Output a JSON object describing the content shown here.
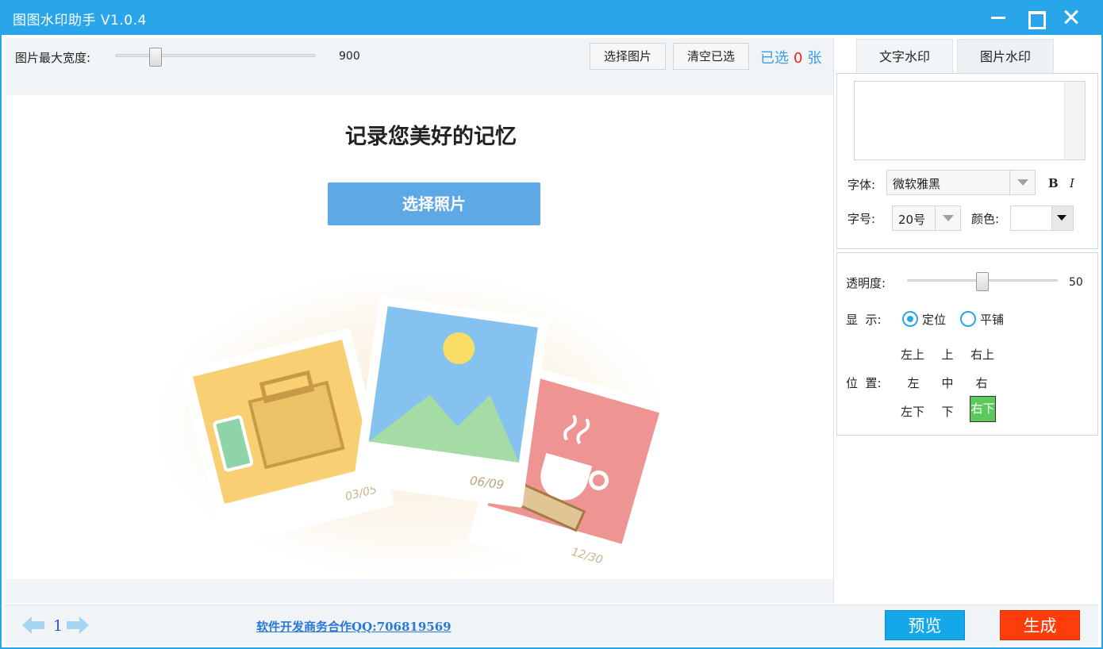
{
  "window": {
    "title": "图图水印助手 V1.0.4"
  },
  "toolbar": {
    "max_width_label": "图片最大宽度:",
    "max_width_value": "900",
    "max_width_slider": {
      "min": 0,
      "max": 5000,
      "value": 900
    },
    "select_images_label": "选择图片",
    "clear_selected_label": "清空已选",
    "selected_prefix": "已选",
    "selected_count": "0",
    "selected_suffix": "张"
  },
  "canvas": {
    "heading": "记录您美好的记忆",
    "choose_photo_label": "选择照片",
    "photo_dates": [
      "03/05",
      "06/09",
      "12/30"
    ]
  },
  "bottom": {
    "page_number": "1",
    "business_link": "软件开发商务合作QQ:706819569",
    "preview_label": "预览",
    "generate_label": "生成"
  },
  "tabs": [
    {
      "label": "文字水印",
      "active": true
    },
    {
      "label": "图片水印",
      "active": false
    }
  ],
  "text_watermark": {
    "text_value": "",
    "font_label": "字体:",
    "font_value": "微软雅黑",
    "bold_label": "B",
    "italic_label": "I",
    "size_label": "字号:",
    "size_value": "20号",
    "color_label": "颜色:",
    "color_value": "#ffffff"
  },
  "display": {
    "opacity_label": "透明度:",
    "opacity_value": "50",
    "opacity_slider": {
      "min": 0,
      "max": 100,
      "value": 50
    },
    "display_label": "显  示:",
    "mode_locate": "定位",
    "mode_tile": "平铺",
    "mode_selected": "定位",
    "position_label": "位  置:",
    "positions": [
      "左上",
      "上",
      "右上",
      "左",
      "中",
      "右",
      "左下",
      "下",
      "右下"
    ],
    "position_selected": "右下"
  },
  "colors": {
    "accent": "#29a6ea",
    "preview_button": "#14a8ea",
    "generate_button": "#ff3d0a",
    "selected_position": "#5cc95c",
    "count_number": "#ee2222"
  }
}
